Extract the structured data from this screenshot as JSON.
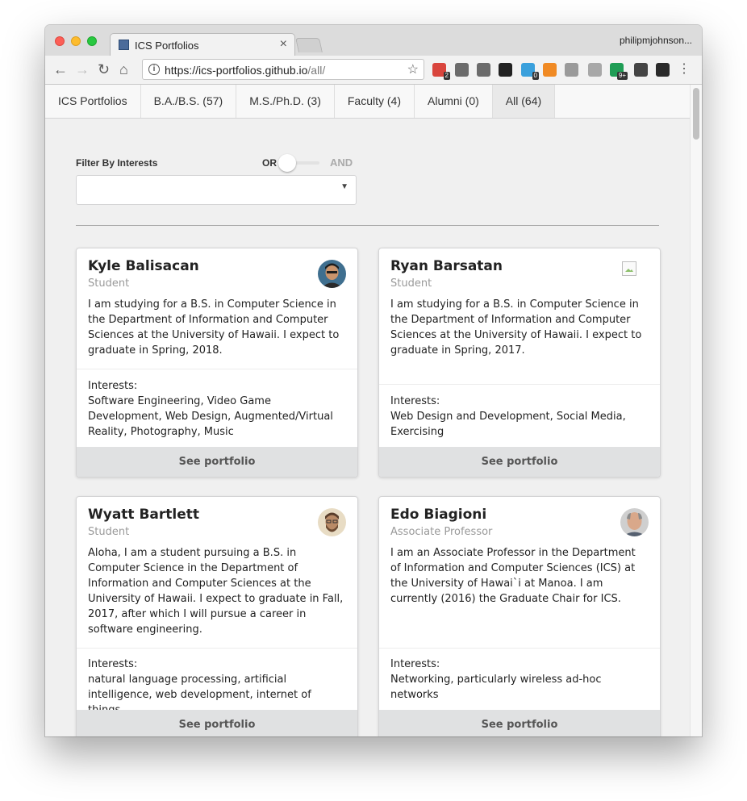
{
  "browser": {
    "tab_title": "ICS Portfolios",
    "tab_close": "×",
    "profile_name": "philipmjohnson...",
    "url_host": "https://ics-portfolios.github.io",
    "url_path": "/all/",
    "extensions": [
      {
        "name": "ext-lastpass-icon",
        "color": "#d9453d",
        "badge": "2"
      },
      {
        "name": "ext-sync-icon",
        "color": "#6b6b6b",
        "badge": ""
      },
      {
        "name": "ext-info-icon",
        "color": "#6b6b6b",
        "badge": ""
      },
      {
        "name": "ext-jb-icon",
        "color": "#222222",
        "badge": ""
      },
      {
        "name": "ext-puzzle-icon",
        "color": "#3aa0dc",
        "badge": "0"
      },
      {
        "name": "ext-chart-icon",
        "color": "#f08a24",
        "badge": ""
      },
      {
        "name": "ext-camera-icon",
        "color": "#9a9a9a",
        "badge": ""
      },
      {
        "name": "ext-drive-icon",
        "color": "#a8a8a8",
        "badge": ""
      },
      {
        "name": "ext-hangouts-icon",
        "color": "#1f9d55",
        "badge": "9+"
      },
      {
        "name": "ext-eyedropper-icon",
        "color": "#444444",
        "badge": ""
      },
      {
        "name": "ext-color-wheel-icon",
        "color": "#2a2a2a",
        "badge": ""
      }
    ]
  },
  "nav": {
    "items": [
      {
        "label": "ICS Portfolios",
        "active": false
      },
      {
        "label": "B.A./B.S. (57)",
        "active": false
      },
      {
        "label": "M.S./Ph.D. (3)",
        "active": false
      },
      {
        "label": "Faculty (4)",
        "active": false
      },
      {
        "label": "Alumni (0)",
        "active": false
      },
      {
        "label": "All (64)",
        "active": true
      }
    ]
  },
  "filter": {
    "label": "Filter By Interests",
    "or_label": "OR",
    "and_label": "AND",
    "mode": "OR",
    "selected": ""
  },
  "cards": [
    {
      "name": "Kyle Balisacan",
      "role": "Student",
      "description": "I am studying for a B.S. in Computer Science in the Department of Information and Computer Sciences at the University of Hawaii. I expect to graduate in Spring, 2018.",
      "interests_label": "Interests:",
      "interests": "Software Engineering, Video Game Development, Web Design, Augmented/Virtual Reality, Photography, Music",
      "button": "See portfolio"
    },
    {
      "name": "Ryan Barsatan",
      "role": "Student",
      "description": "I am studying for a B.S. in Computer Science in the Department of Information and Computer Sciences at the University of Hawaii. I expect to graduate in Spring, 2017.",
      "interests_label": "Interests:",
      "interests": "Web Design and Development, Social Media, Exercising",
      "button": "See portfolio"
    },
    {
      "name": "Wyatt Bartlett",
      "role": "Student",
      "description": "Aloha, I am a student pursuing a B.S. in Computer Science in the Department of Information and Computer Sciences at the University of Hawaii. I expect to graduate in Fall, 2017, after which I will pursue a career in software engineering.",
      "interests_label": "Interests:",
      "interests": "natural language processing, artificial intelligence, web development, internet of things",
      "button": "See portfolio"
    },
    {
      "name": "Edo Biagioni",
      "role": "Associate Professor",
      "description": "I am an Associate Professor in the Department of Information and Computer Sciences (ICS) at the University of Hawai`i at Manoa. I am currently (2016) the Graduate Chair for ICS.",
      "interests_label": "Interests:",
      "interests": "Networking, particularly wireless ad-hoc networks",
      "button": "See portfolio"
    }
  ]
}
